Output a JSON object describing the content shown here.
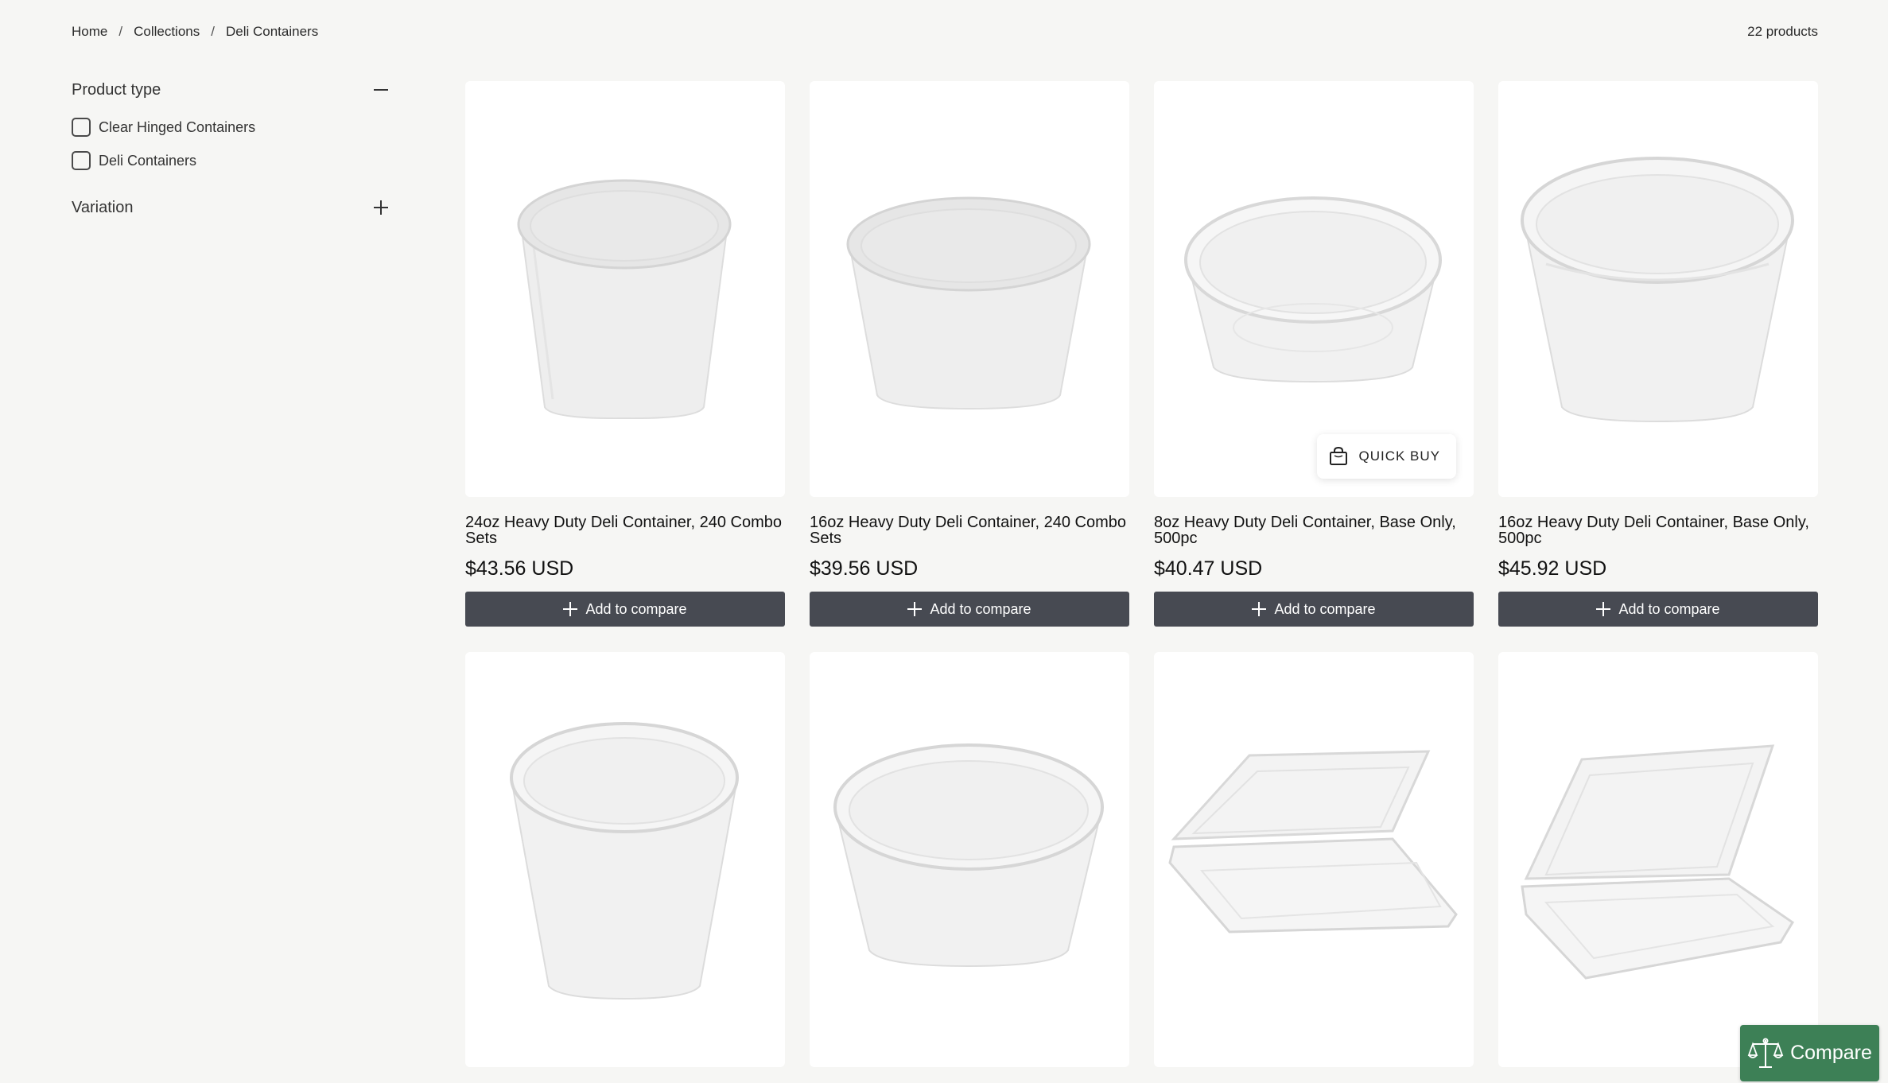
{
  "breadcrumb": {
    "items": [
      "Home",
      "Collections",
      "Deli Containers"
    ],
    "separator": "/"
  },
  "product_count": "22 products",
  "filters": {
    "product_type": {
      "label": "Product type",
      "expanded": true,
      "options": [
        "Clear Hinged Containers",
        "Deli Containers"
      ]
    },
    "variation": {
      "label": "Variation",
      "expanded": false
    }
  },
  "products": [
    {
      "title": "24oz Heavy Duty Deli Container, 240 Combo Sets",
      "price": "$43.56 USD",
      "compare_label": "Add to compare",
      "image": "tall-deli-container-with-lid"
    },
    {
      "title": "16oz Heavy Duty Deli Container, 240 Combo Sets",
      "price": "$39.56 USD",
      "compare_label": "Add to compare",
      "image": "medium-deli-container-with-lid"
    },
    {
      "title": "8oz Heavy Duty Deli Container, Base Only, 500pc",
      "price": "$40.47 USD",
      "compare_label": "Add to compare",
      "image": "short-deli-container-base",
      "quick_buy": "QUICK BUY"
    },
    {
      "title": "16oz Heavy Duty Deli Container, Base Only, 500pc",
      "price": "$45.92 USD",
      "compare_label": "Add to compare",
      "image": "medium-deli-container-base"
    },
    {
      "image": "tall-deli-container-base"
    },
    {
      "image": "medium-deli-container-base"
    },
    {
      "image": "clear-hinged-container"
    },
    {
      "image": "clear-hinged-container"
    }
  ],
  "compare_float": {
    "label": "Compare",
    "icon": "scale-icon",
    "color": "#3d8056"
  },
  "colors": {
    "button": "#474a52",
    "background": "#f6f6f4"
  }
}
